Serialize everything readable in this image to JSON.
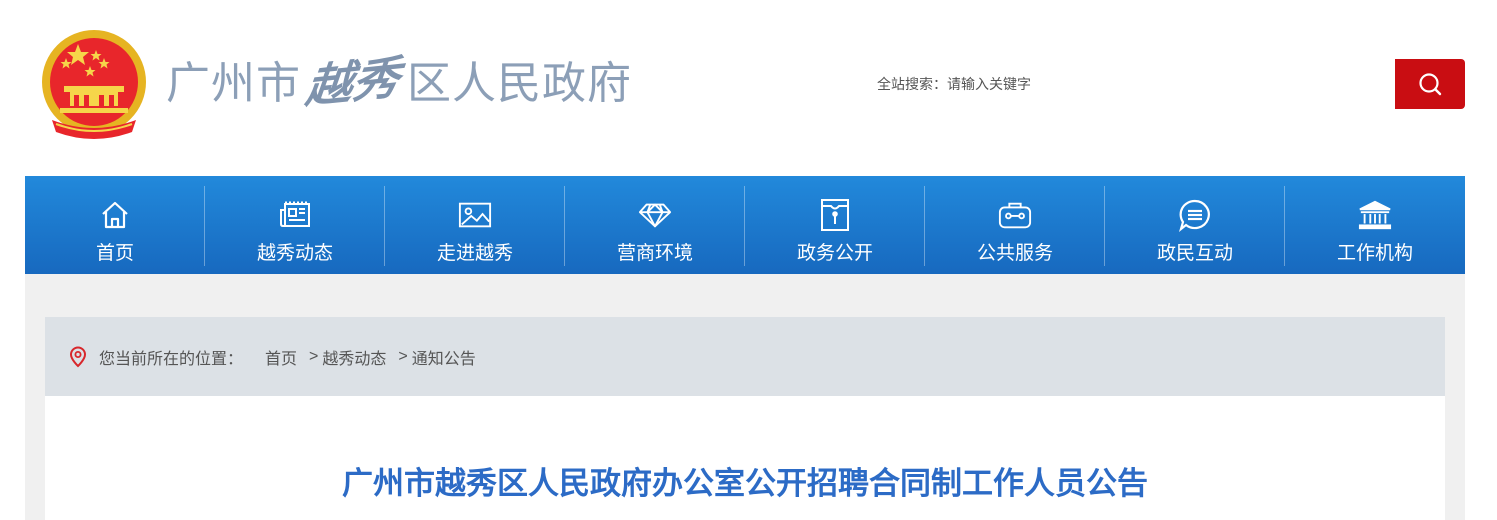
{
  "header": {
    "title_city": "广州市",
    "title_callig": "越秀",
    "title_district": "区人民政府"
  },
  "search": {
    "label": "全站搜索：",
    "placeholder": "请输入关键字",
    "button_icon": "search-icon",
    "button_color": "#c90d12"
  },
  "nav": {
    "color": "#1d79d0",
    "items": [
      {
        "label": "首页",
        "icon": "home-icon"
      },
      {
        "label": "越秀动态",
        "icon": "news-icon"
      },
      {
        "label": "走进越秀",
        "icon": "image-icon"
      },
      {
        "label": "营商环境",
        "icon": "diamond-icon"
      },
      {
        "label": "政务公开",
        "icon": "envelope-icon"
      },
      {
        "label": "公共服务",
        "icon": "briefcase-icon"
      },
      {
        "label": "政民互动",
        "icon": "chat-icon"
      },
      {
        "label": "工作机构",
        "icon": "building-icon"
      }
    ]
  },
  "breadcrumb": {
    "prefix": "您当前所在的位置：",
    "items": [
      "首页",
      "越秀动态",
      "通知公告"
    ],
    "separator": ">"
  },
  "article": {
    "title": "广州市越秀区人民政府办公室公开招聘合同制工作人员公告",
    "title_color": "#2c6bc6"
  }
}
